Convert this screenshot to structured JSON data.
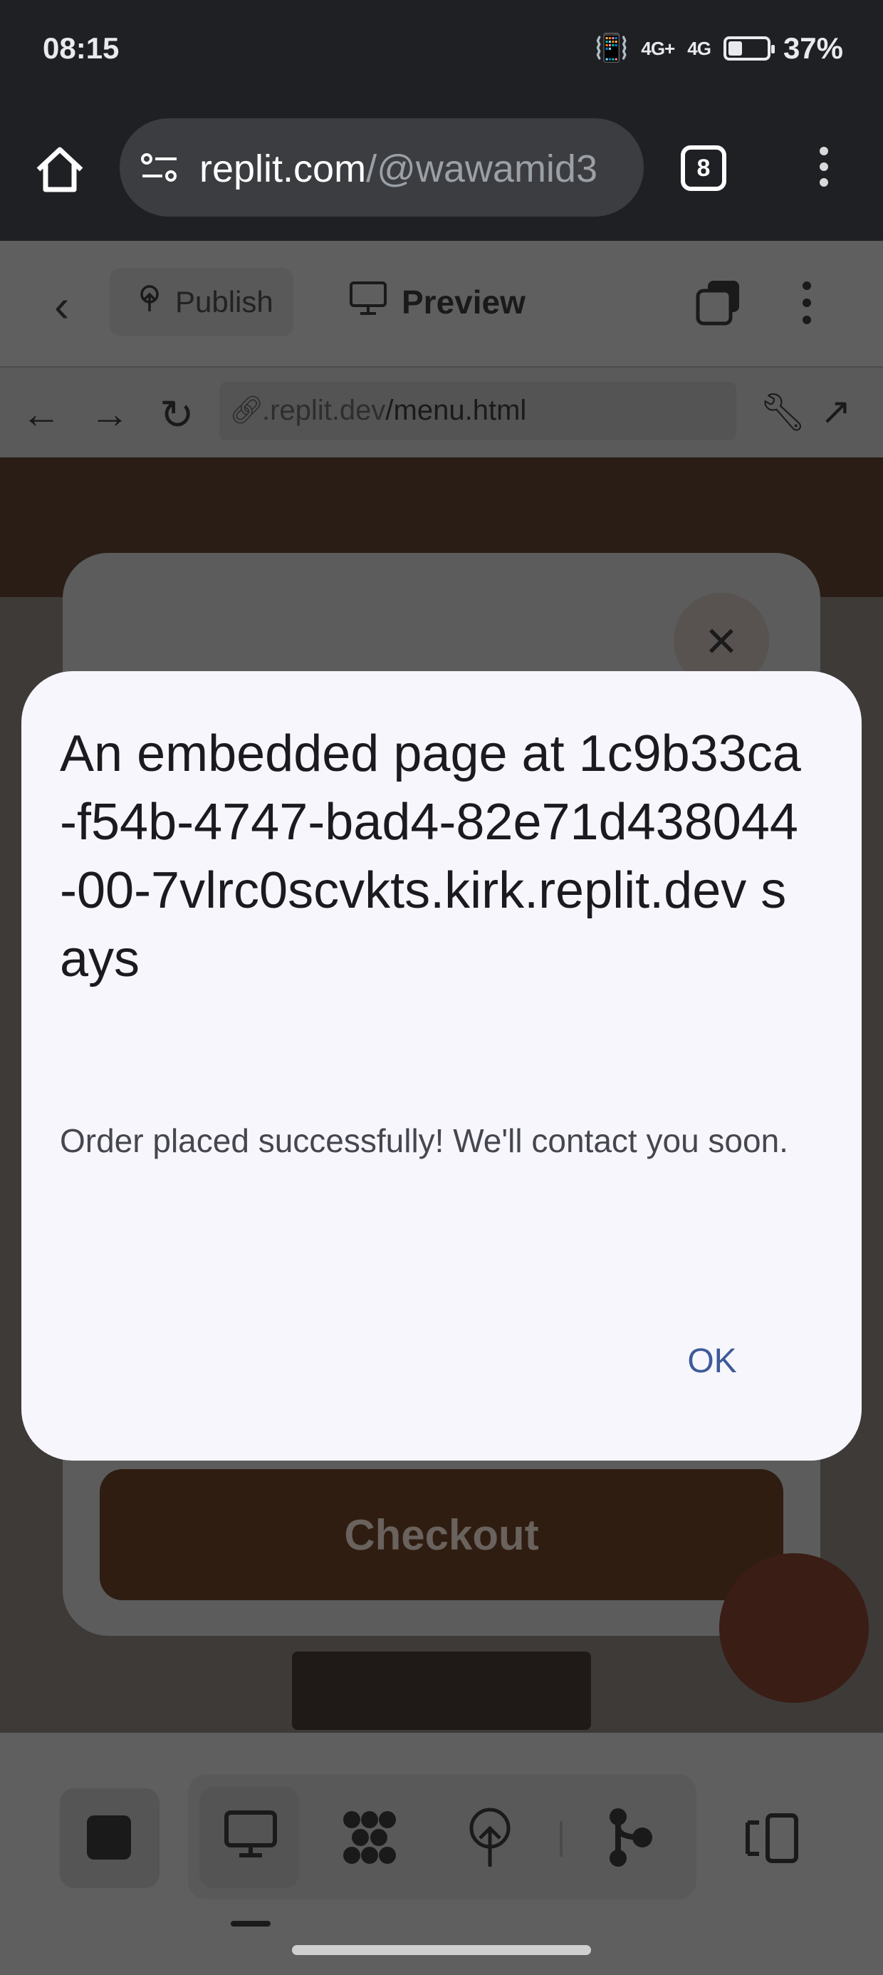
{
  "status_bar": {
    "time": "08:15",
    "signal1": "4G+",
    "signal2": "4G",
    "battery_percent": "37%",
    "battery_level": 0.37
  },
  "browser": {
    "url_host": "replit.com",
    "url_path": "/@wawamid3",
    "tab_count": "8"
  },
  "replit": {
    "publish_label": "Publish",
    "preview_label": "Preview",
    "url_domain": ".replit.dev",
    "url_path": "/menu.html"
  },
  "app": {
    "checkout_label": "Checkout",
    "close_glyph": "×"
  },
  "dialog": {
    "title": "An embedded page at 1c9b33ca-f54b-4747-bad4-82e71d438044-00-7vlrc0scvkts.kirk.replit.dev says",
    "message": "Order placed successfully! We'll contact you soon.",
    "ok_label": "OK"
  },
  "colors": {
    "dialog_bg": "#f7f6fc",
    "ok_accent": "#3d5a98",
    "checkout_bg": "#2f1d12",
    "chrome_bg": "#1f2024"
  }
}
